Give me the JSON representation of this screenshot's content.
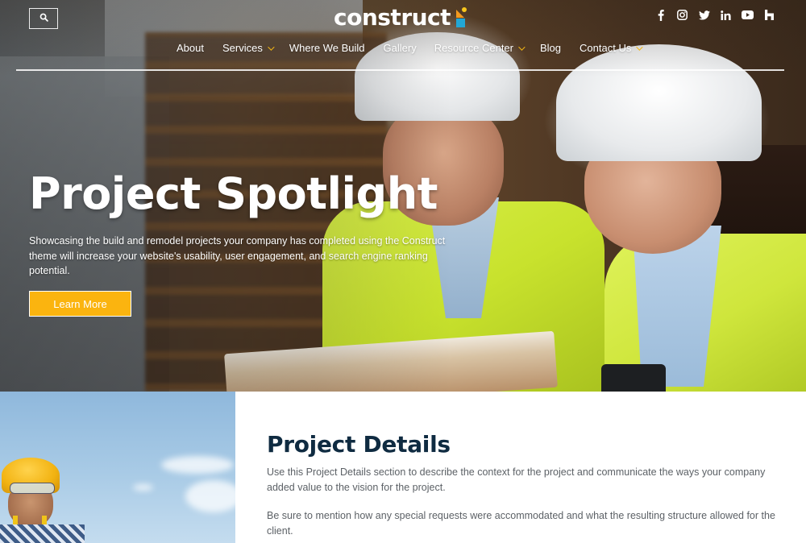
{
  "header": {
    "search_icon": "search-icon",
    "logo_text": "construct",
    "logo_colors": {
      "orange": "#f39a1f",
      "yellow": "#f7c61c",
      "blue": "#22a7d6"
    },
    "social_icons": [
      "facebook-icon",
      "instagram-icon",
      "twitter-icon",
      "linkedin-icon",
      "youtube-icon",
      "houzz-icon"
    ],
    "nav": [
      {
        "label": "About",
        "has_dropdown": false
      },
      {
        "label": "Services",
        "has_dropdown": true
      },
      {
        "label": "Where We Build",
        "has_dropdown": false
      },
      {
        "label": "Gallery",
        "has_dropdown": false
      },
      {
        "label": "Resource Center",
        "has_dropdown": true
      },
      {
        "label": "Blog",
        "has_dropdown": false
      },
      {
        "label": "Contact Us",
        "has_dropdown": true
      }
    ],
    "dropdown_chevron_color": "#f1b514"
  },
  "hero": {
    "title": "Project Spotlight",
    "description": "Showcasing the build and remodel projects your company has completed using the Construct theme will increase your website's usability, user engagement, and search engine ranking potential.",
    "cta_label": "Learn More",
    "cta_color": "#fbb40f"
  },
  "details": {
    "title": "Project Details",
    "title_color": "#0f2b41",
    "paragraphs": [
      "Use this Project Details section to describe the context for the project and communicate the ways your company added value to the vision for the project.",
      "Be sure to mention how any special requests were accommodated and what the resulting structure allowed for the client."
    ]
  }
}
